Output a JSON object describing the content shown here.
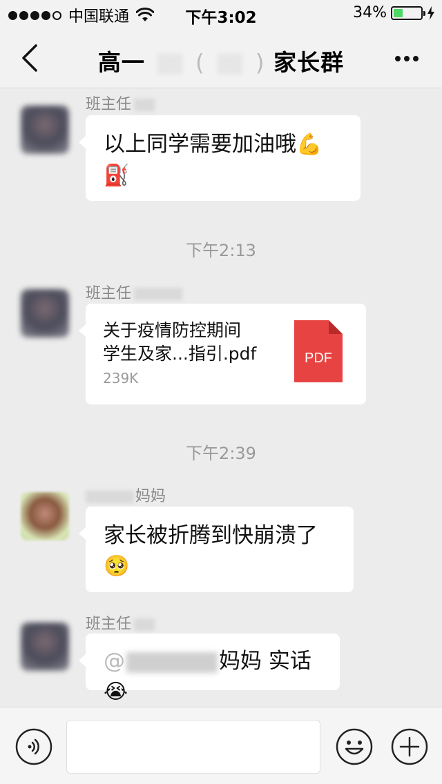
{
  "status_bar": {
    "carrier": "中国联通",
    "time": "下午3:02",
    "battery": "34%",
    "battery_level": 0.34,
    "signal_dots_filled": 4,
    "signal_dots_total": 5
  },
  "header": {
    "title_prefix": "高一",
    "title_paren_open": "(",
    "title_paren_close": ")",
    "title_suffix": "家长群",
    "back_icon": "chevron-left-icon",
    "more_icon": "more-dots-icon"
  },
  "messages": [
    {
      "sender": "班主任",
      "text": "以上同学需要加油哦",
      "emojis": [
        "💪",
        "⛽"
      ]
    },
    {
      "timestamp": "下午2:13"
    },
    {
      "sender": "班主任",
      "file": {
        "name_line1": "关于疫情防控期间",
        "name_line2": "学生及家...指引.pdf",
        "size": "239K",
        "icon_label": "PDF",
        "icon_color": "#e84343"
      }
    },
    {
      "timestamp": "下午2:39"
    },
    {
      "sender_suffix": "妈妈",
      "text": "家长被折腾到快崩溃了",
      "emoji": "🥺"
    },
    {
      "sender": "班主任",
      "mention_prefix": "@",
      "mention_suffix": "妈妈",
      "text": "实话",
      "emoji": "😭"
    }
  ],
  "input_bar": {
    "voice_icon": "voice-icon",
    "emoji_icon": "emoji-icon",
    "plus_icon": "plus-icon"
  },
  "colors": {
    "background": "#ececec",
    "bubble": "#ffffff",
    "battery_fill": "#4cd964",
    "pdf_red": "#e84343"
  }
}
